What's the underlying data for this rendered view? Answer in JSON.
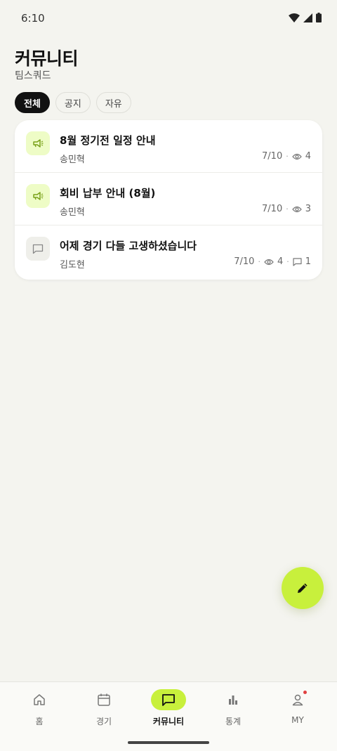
{
  "status_bar": {
    "time": "6:10"
  },
  "header": {
    "title": "커뮤니티",
    "subtitle": "팀스쿼드"
  },
  "filters": [
    {
      "label": "전체",
      "active": true
    },
    {
      "label": "공지",
      "active": false
    },
    {
      "label": "자유",
      "active": false
    }
  ],
  "posts": [
    {
      "type": "notice",
      "icon": "megaphone-icon",
      "title": "8월 정기전 일정 안내",
      "author": "송민혁",
      "date": "7/10",
      "views": "4"
    },
    {
      "type": "notice",
      "icon": "megaphone-icon",
      "title": "회비 납부 안내 (8월)",
      "author": "송민혁",
      "date": "7/10",
      "views": "3"
    },
    {
      "type": "free",
      "icon": "chat-bubble-icon",
      "title": "어제 경기 다들 고생하셨습니다",
      "author": "김도현",
      "date": "7/10",
      "views": "4",
      "comments": "1"
    }
  ],
  "fab": {
    "icon": "pencil-icon"
  },
  "bottom_nav": [
    {
      "label": "홈",
      "icon": "home-icon",
      "active": false
    },
    {
      "label": "경기",
      "icon": "calendar-icon",
      "active": false
    },
    {
      "label": "커뮤니티",
      "icon": "chat-bubble-icon",
      "active": true
    },
    {
      "label": "통계",
      "icon": "bar-chart-icon",
      "active": false
    },
    {
      "label": "MY",
      "icon": "user-icon",
      "active": false,
      "has_badge": true
    }
  ],
  "colors": {
    "accent": "#c8f03c",
    "background": "#f4f4ef",
    "notice_icon_bg": "#eefcc6"
  }
}
